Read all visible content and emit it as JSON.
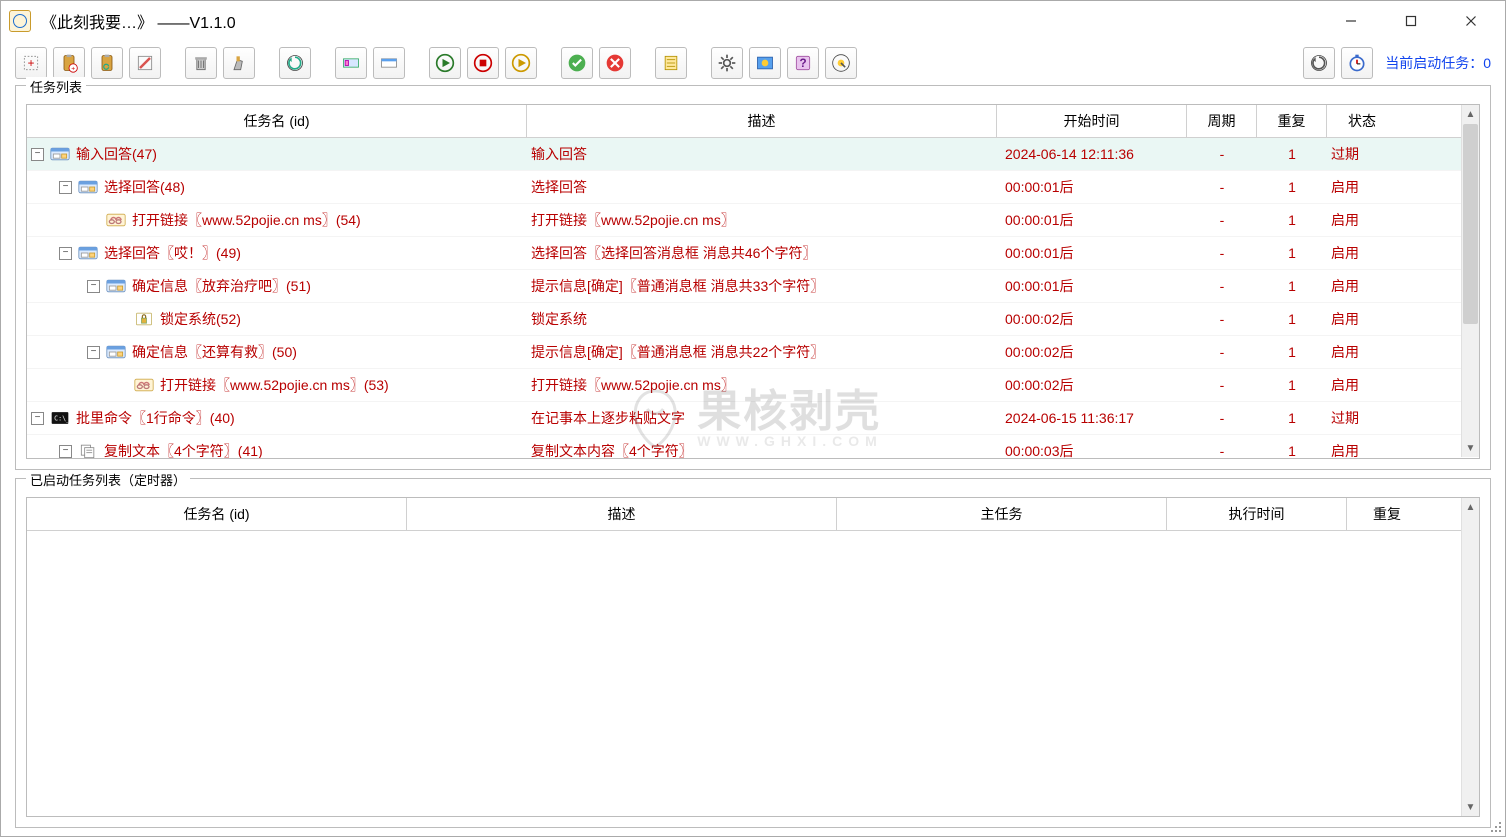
{
  "titlebar": {
    "title": "《此刻我要…》 ——V1.1.0"
  },
  "toolbar_status": {
    "label": "当前启动任务：",
    "count": "0"
  },
  "sections": {
    "tasks_legend": "任务列表",
    "running_legend": "已启动任务列表（定时器）"
  },
  "columns_tasks": {
    "name": "任务名 (id)",
    "desc": "描述",
    "start": "开始时间",
    "cycle": "周期",
    "repeat": "重复",
    "status": "状态"
  },
  "columns_running": {
    "name": "任务名 (id)",
    "desc": "描述",
    "main": "主任务",
    "time": "执行时间",
    "repeat": "重复"
  },
  "rows": [
    {
      "indent": 0,
      "toggle": "-",
      "icon": "form",
      "name": "输入回答(47)",
      "desc": "输入回答",
      "start": "2024-06-14 12:11:36",
      "cycle": "-",
      "repeat": "1",
      "status": "过期",
      "highlight": true
    },
    {
      "indent": 1,
      "toggle": "-",
      "icon": "form",
      "name": "选择回答(48)",
      "desc": "选择回答",
      "start": "00:00:01后",
      "cycle": "-",
      "repeat": "1",
      "status": "启用",
      "highlight": false
    },
    {
      "indent": 2,
      "toggle": "",
      "icon": "link",
      "name": "打开链接〖www.52pojie.cn ms〗(54)",
      "desc": "打开链接〖www.52pojie.cn ms〗",
      "start": "00:00:01后",
      "cycle": "-",
      "repeat": "1",
      "status": "启用",
      "highlight": false
    },
    {
      "indent": 1,
      "toggle": "-",
      "icon": "form",
      "name": "选择回答〖哎！〗(49)",
      "desc": "选择回答〖选择回答消息框 消息共46个字符〗",
      "start": "00:00:01后",
      "cycle": "-",
      "repeat": "1",
      "status": "启用",
      "highlight": false
    },
    {
      "indent": 2,
      "toggle": "-",
      "icon": "form",
      "name": "确定信息〖放弃治疗吧〗(51)",
      "desc": "提示信息[确定]〖普通消息框 消息共33个字符〗",
      "start": "00:00:01后",
      "cycle": "-",
      "repeat": "1",
      "status": "启用",
      "highlight": false
    },
    {
      "indent": 3,
      "toggle": "",
      "icon": "lock",
      "name": "锁定系统(52)",
      "desc": "锁定系统",
      "start": "00:00:02后",
      "cycle": "-",
      "repeat": "1",
      "status": "启用",
      "highlight": false
    },
    {
      "indent": 2,
      "toggle": "-",
      "icon": "form",
      "name": "确定信息〖还算有救〗(50)",
      "desc": "提示信息[确定]〖普通消息框 消息共22个字符〗",
      "start": "00:00:02后",
      "cycle": "-",
      "repeat": "1",
      "status": "启用",
      "highlight": false
    },
    {
      "indent": 3,
      "toggle": "",
      "icon": "link",
      "name": "打开链接〖www.52pojie.cn ms〗(53)",
      "desc": "打开链接〖www.52pojie.cn ms〗",
      "start": "00:00:02后",
      "cycle": "-",
      "repeat": "1",
      "status": "启用",
      "highlight": false
    },
    {
      "indent": 0,
      "toggle": "-",
      "icon": "terminal",
      "name": "批里命令〖1行命令〗(40)",
      "desc": "在记事本上逐步粘贴文字",
      "start": "2024-06-15 11:36:17",
      "cycle": "-",
      "repeat": "1",
      "status": "过期",
      "highlight": false
    },
    {
      "indent": 1,
      "toggle": "-",
      "icon": "copy",
      "name": "复制文本〖4个字符〗(41)",
      "desc": "复制文本内容〖4个字符〗",
      "start": "00:00:03后",
      "cycle": "-",
      "repeat": "1",
      "status": "启用",
      "highlight": false
    }
  ],
  "watermark": {
    "text": "果核剥壳",
    "sub": "WWW.GHXI.COM"
  }
}
